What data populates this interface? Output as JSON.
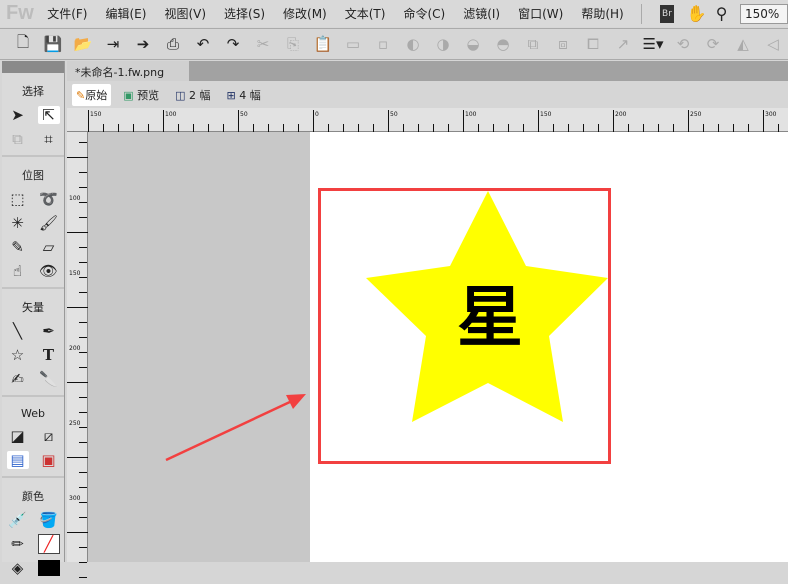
{
  "app": {
    "logo": "Fw"
  },
  "menu": [
    "文件(F)",
    "编辑(E)",
    "视图(V)",
    "选择(S)",
    "修改(M)",
    "文本(T)",
    "命令(C)",
    "滤镜(I)",
    "窗口(W)",
    "帮助(H)"
  ],
  "menu_right": {
    "bridge": "Br",
    "zoom": "150%"
  },
  "tools": {
    "sections": [
      "选择",
      "位图",
      "矢量",
      "Web",
      "颜色"
    ],
    "text_tool": "T"
  },
  "document": {
    "tab": "*未命名-1.fw.png",
    "close": "×"
  },
  "views": [
    "原始",
    "预览",
    "2 幅",
    "4 幅"
  ],
  "ruler": {
    "h_labels": [
      "150",
      "100",
      "50",
      "0",
      "50",
      "100",
      "150",
      "200",
      "250",
      "300"
    ],
    "v_labels": [
      "100",
      "150",
      "200",
      "250",
      "300"
    ]
  },
  "canvas": {
    "star_text": "星",
    "star_color": "#ffff00",
    "highlight_color": "#f24040"
  }
}
